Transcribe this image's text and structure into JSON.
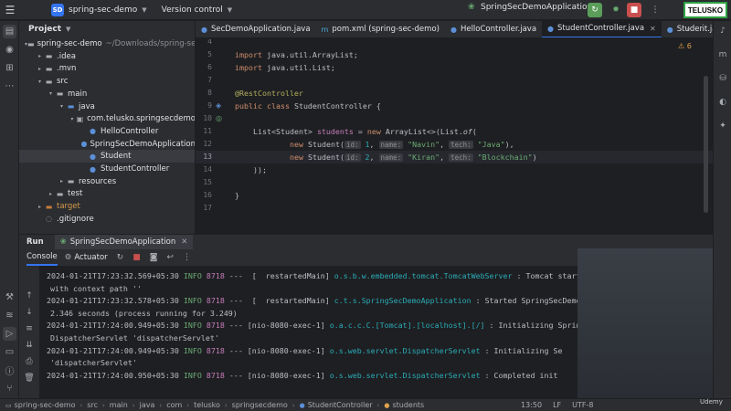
{
  "titlebar": {
    "project_badge": "SD",
    "project_name": "spring-sec-demo",
    "version_control": "Version control",
    "run_config": "SpringSecDemoApplication",
    "logo": "TELUSKO"
  },
  "project_panel": {
    "title": "Project",
    "tree": [
      {
        "label": "spring-sec-demo",
        "note": "~/Downloads/spring-se",
        "indent": 0,
        "arrow": "▾",
        "icon": "folder"
      },
      {
        "label": ".idea",
        "indent": 1,
        "arrow": "▸",
        "icon": "folder"
      },
      {
        "label": ".mvn",
        "indent": 1,
        "arrow": "▸",
        "icon": "folder"
      },
      {
        "label": "src",
        "indent": 1,
        "arrow": "▾",
        "icon": "folder"
      },
      {
        "label": "main",
        "indent": 2,
        "arrow": "▾",
        "icon": "folder"
      },
      {
        "label": "java",
        "indent": 3,
        "arrow": "▾",
        "icon": "folder-blue"
      },
      {
        "label": "com.telusko.springsecdemo",
        "indent": 4,
        "arrow": "▾",
        "icon": "package"
      },
      {
        "label": "HelloController",
        "indent": 5,
        "arrow": "",
        "icon": "class"
      },
      {
        "label": "SpringSecDemoApplication",
        "indent": 5,
        "arrow": "",
        "icon": "class"
      },
      {
        "label": "Student",
        "indent": 5,
        "arrow": "",
        "icon": "class",
        "selected": true
      },
      {
        "label": "StudentController",
        "indent": 5,
        "arrow": "",
        "icon": "class"
      },
      {
        "label": "resources",
        "indent": 3,
        "arrow": "▸",
        "icon": "folder"
      },
      {
        "label": "test",
        "indent": 2,
        "arrow": "▸",
        "icon": "folder"
      },
      {
        "label": "target",
        "indent": 1,
        "arrow": "▸",
        "icon": "folder-orange",
        "orange": true
      },
      {
        "label": ".gitignore",
        "indent": 1,
        "arrow": "",
        "icon": "file"
      }
    ]
  },
  "tabs": [
    {
      "label": "SecDemoApplication.java",
      "icon": "class-icon",
      "active": false
    },
    {
      "label": "pom.xml (spring-sec-demo)",
      "icon": "maven-icon",
      "active": false
    },
    {
      "label": "HelloController.java",
      "icon": "class-icon",
      "active": false
    },
    {
      "label": "StudentController.java",
      "icon": "class-icon",
      "active": true
    },
    {
      "label": "Student.java",
      "icon": "class-icon",
      "active": false
    }
  ],
  "editor": {
    "line_numbers": [
      "4",
      "5",
      "6",
      "7",
      "8",
      "9",
      "10",
      "11",
      "12",
      "13",
      "14",
      "15",
      "16",
      "17"
    ],
    "current_line": "13",
    "warning_count": "6",
    "code": {
      "l5_kw": "import",
      "l5_rest": " java.util.ArrayList;",
      "l6_kw": "import",
      "l6_rest": " java.util.List;",
      "l8_ann": "@RestController",
      "l9_kw": "public class",
      "l9_rest": " StudentController {",
      "l11_a": "List<Student> ",
      "l11_field": "students",
      "l11_b": " = ",
      "l11_kw": "new",
      "l11_c": " ArrayList<>(List.",
      "l11_of": "of",
      "l11_d": "(",
      "l12_kw": "new",
      "l12_a": " Student(",
      "l12_h1": "id:",
      "l12_n1": "1",
      "l12_h2": "name:",
      "l12_s1": "\"Navin\"",
      "l12_h3": "tech:",
      "l12_s2": "\"Java\"",
      "l12_end": "),",
      "l13_kw": "new",
      "l13_a": " Student(",
      "l13_h1": "id:",
      "l13_n1": "2",
      "l13_h2": "name:",
      "l13_s1": "\"Kiran\"",
      "l13_h3": "tech:",
      "l13_s2": "\"Blockchain\"",
      "l13_end": ")",
      "l14": "));",
      "l16": "}"
    }
  },
  "run_panel": {
    "title": "Run",
    "tab": "SpringSecDemoApplication",
    "console_tab": "Console",
    "actuator_tab": "Actuator",
    "logs": [
      {
        "ts": "2024-01-21T17:23:32.569+05:30",
        "level": "INFO",
        "pid": "8718",
        "thread": "---  [  restartedMain]",
        "cls": "o.s.b.w.embedded.tomcat.TomcatWebServer",
        "msg": " : Tomcat started on port"
      },
      {
        "cont": "with context path ''"
      },
      {
        "ts": "2024-01-21T17:23:32.578+05:30",
        "level": "INFO",
        "pid": "8718",
        "thread": "---  [  restartedMain]",
        "cls": "c.t.s.SpringSecDemoApplication",
        "msg": " : Started SpringSecDemoAp"
      },
      {
        "cont": "2.346 seconds (process running for 3.249)"
      },
      {
        "ts": "2024-01-21T17:24:00.949+05:30",
        "level": "INFO",
        "pid": "8718",
        "thread": "--- [nio-8080-exec-1]",
        "cls": "o.a.c.c.C.[Tomcat].[localhost].[/]",
        "msg": " : Initializing Sprin"
      },
      {
        "cont": "DispatcherServlet 'dispatcherServlet'"
      },
      {
        "ts": "2024-01-21T17:24:00.949+05:30",
        "level": "INFO",
        "pid": "8718",
        "thread": "--- [nio-8080-exec-1]",
        "cls": "o.s.web.servlet.DispatcherServlet",
        "msg": " : Initializing Se"
      },
      {
        "cont": "'dispatcherServlet'"
      },
      {
        "ts": "2024-01-21T17:24:00.950+05:30",
        "level": "INFO",
        "pid": "8718",
        "thread": "--- [nio-8080-exec-1]",
        "cls": "o.s.web.servlet.DispatcherServlet",
        "msg": " : Completed init"
      }
    ]
  },
  "status_bar": {
    "breadcrumb": [
      "spring-sec-demo",
      "src",
      "main",
      "java",
      "com",
      "telusko",
      "springsecdemo",
      "StudentController",
      "students"
    ],
    "cursor": "13:50",
    "line_sep": "LF",
    "encoding": "UTF-8",
    "watermark": "Udemy"
  },
  "colors": {
    "accent": "#3574f0",
    "keyword": "#cf8e6d",
    "string": "#6aab73",
    "number": "#2aacb8",
    "annotation": "#b3ae60",
    "field": "#c77dbb"
  }
}
